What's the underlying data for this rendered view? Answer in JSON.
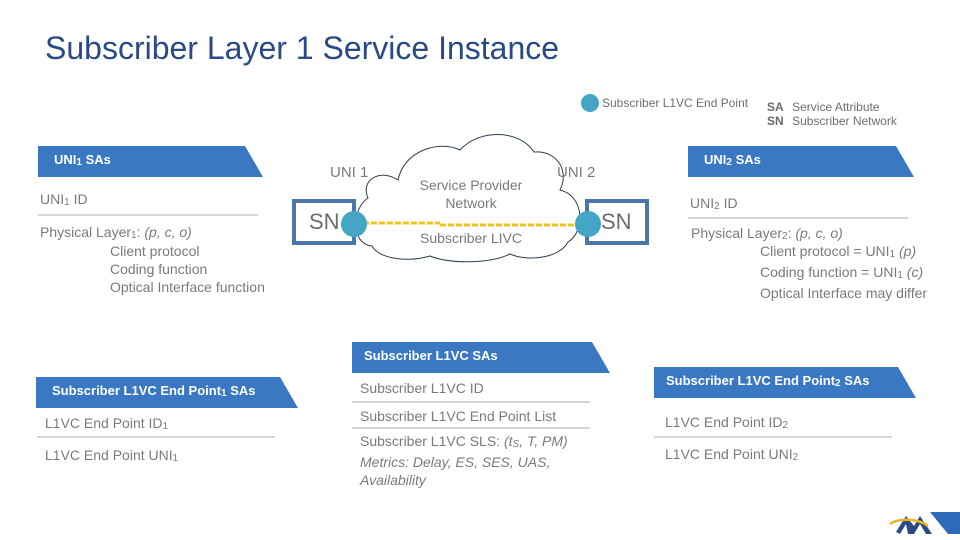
{
  "title": "Subscriber Layer 1 Service Instance",
  "legend": {
    "endpoint_label": "Subscriber L1VC End Point",
    "abbreviations": [
      {
        "abbr": "SA",
        "meaning": "Service Attribute"
      },
      {
        "abbr": "SN",
        "meaning": "Subscriber Network"
      }
    ]
  },
  "diagram": {
    "uni1_label": "UNI 1",
    "uni2_label": "UNI 2",
    "sn_left": "SN",
    "sn_right": "SN",
    "cloud_line1": "Service Provider",
    "cloud_line2": "Network",
    "l1vc_label": "Subscriber LIVC",
    "colors": {
      "endpoint": "#45a5c6",
      "l1vc_line": "#f0c419",
      "sn_border": "#4b76a8",
      "band": "#3a78c3",
      "title": "#2a4a86"
    }
  },
  "uni1_sas": {
    "header_main": "UNI",
    "header_sub": "1",
    "header_rest": " SAs",
    "id_main": "UNI",
    "id_sub": "1",
    "id_rest": " ID",
    "phys_main": "Physical Layer",
    "phys_sub": "1",
    "phys_colon": ": ",
    "phys_params": "(p, c, o)",
    "items": [
      "Client protocol",
      "Coding function",
      "Optical Interface function"
    ]
  },
  "uni2_sas": {
    "header_main": "UNI",
    "header_sub": "2",
    "header_rest": " SAs",
    "id_main": "UNI",
    "id_sub": "2",
    "id_rest": " ID",
    "phys_main": "Physical Layer",
    "phys_sub": "2",
    "phys_colon": ": ",
    "phys_params": "(p, c, o)",
    "items": [
      {
        "text": "Client protocol = UNI",
        "sub": "1",
        "param": " (p)"
      },
      {
        "text": "Coding function = UNI",
        "sub": "1",
        "param": " (c)"
      },
      {
        "text": "Optical Interface may differ",
        "sub": "",
        "param": ""
      }
    ]
  },
  "l1vc_sas": {
    "header": "Subscriber L1VC SAs",
    "id": "Subscriber L1VC ID",
    "endpoint_list": "Subscriber L1VC End Point List",
    "sls_main": "Subscriber L1VC SLS: ",
    "sls_params_a": "(t",
    "sls_params_sub": "S",
    "sls_params_b": ", T, PM)",
    "metrics": "Metrics: Delay, ES, SES, UAS,",
    "metrics_cont": "Availability"
  },
  "ep1_sas": {
    "header_main": "Subscriber L1VC End Point",
    "header_sub": "1",
    "header_rest": " SAs",
    "id_main": "L1VC End Point ID",
    "id_sub": "1",
    "uni_main": "L1VC End Point UNI",
    "uni_sub": "1"
  },
  "ep2_sas": {
    "header_main": "Subscriber L1VC End Point",
    "header_sub": "2",
    "header_rest": " SAs",
    "id_main": "L1VC End Point ID",
    "id_sub": "2",
    "uni_main": "L1VC End Point UNI",
    "uni_sub": "2"
  },
  "logo": {
    "name": "mef-logo-icon"
  }
}
